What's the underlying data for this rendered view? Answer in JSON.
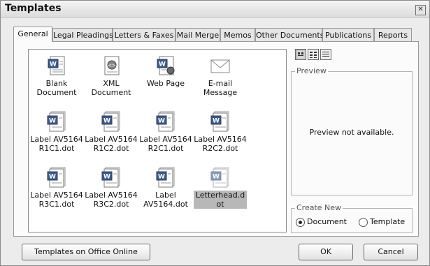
{
  "window": {
    "title": "Templates"
  },
  "tabs": [
    {
      "label": "General",
      "active": true
    },
    {
      "label": "Legal Pleadings"
    },
    {
      "label": "Letters & Faxes"
    },
    {
      "label": "Mail Merge"
    },
    {
      "label": "Memos"
    },
    {
      "label": "Other Documents"
    },
    {
      "label": "Publications"
    },
    {
      "label": "Reports"
    }
  ],
  "templates": [
    {
      "label": "Blank Document",
      "icon": "word-document-icon"
    },
    {
      "label": "XML Document",
      "icon": "xml-document-icon"
    },
    {
      "label": "Web Page",
      "icon": "web-page-icon"
    },
    {
      "label": "E-mail Message",
      "icon": "envelope-icon"
    },
    {
      "label": "Label AV5164 R1C1.dot",
      "icon": "word-template-icon"
    },
    {
      "label": "Label AV5164 R1C2.dot",
      "icon": "word-template-icon"
    },
    {
      "label": "Label AV5164 R2C1.dot",
      "icon": "word-template-icon"
    },
    {
      "label": "Label AV5164 R2C2.dot",
      "icon": "word-template-icon"
    },
    {
      "label": "Label AV5164 R3C1.dot",
      "icon": "word-template-icon"
    },
    {
      "label": "Label AV5164 R3C2.dot",
      "icon": "word-template-icon"
    },
    {
      "label": "Label AV5164.dot",
      "icon": "word-template-icon"
    },
    {
      "label": "Letterhead.dot",
      "icon": "word-template-icon",
      "selected": true
    }
  ],
  "view_buttons": [
    {
      "icon": "large-icons-view-icon",
      "active": true
    },
    {
      "icon": "list-view-icon"
    },
    {
      "icon": "details-view-icon"
    }
  ],
  "preview": {
    "label": "Preview",
    "text": "Preview not available."
  },
  "create_new": {
    "label": "Create New",
    "options": [
      "Document",
      "Template"
    ],
    "selected": "Document"
  },
  "buttons": {
    "online": "Templates on Office Online",
    "ok": "OK",
    "cancel": "Cancel"
  }
}
